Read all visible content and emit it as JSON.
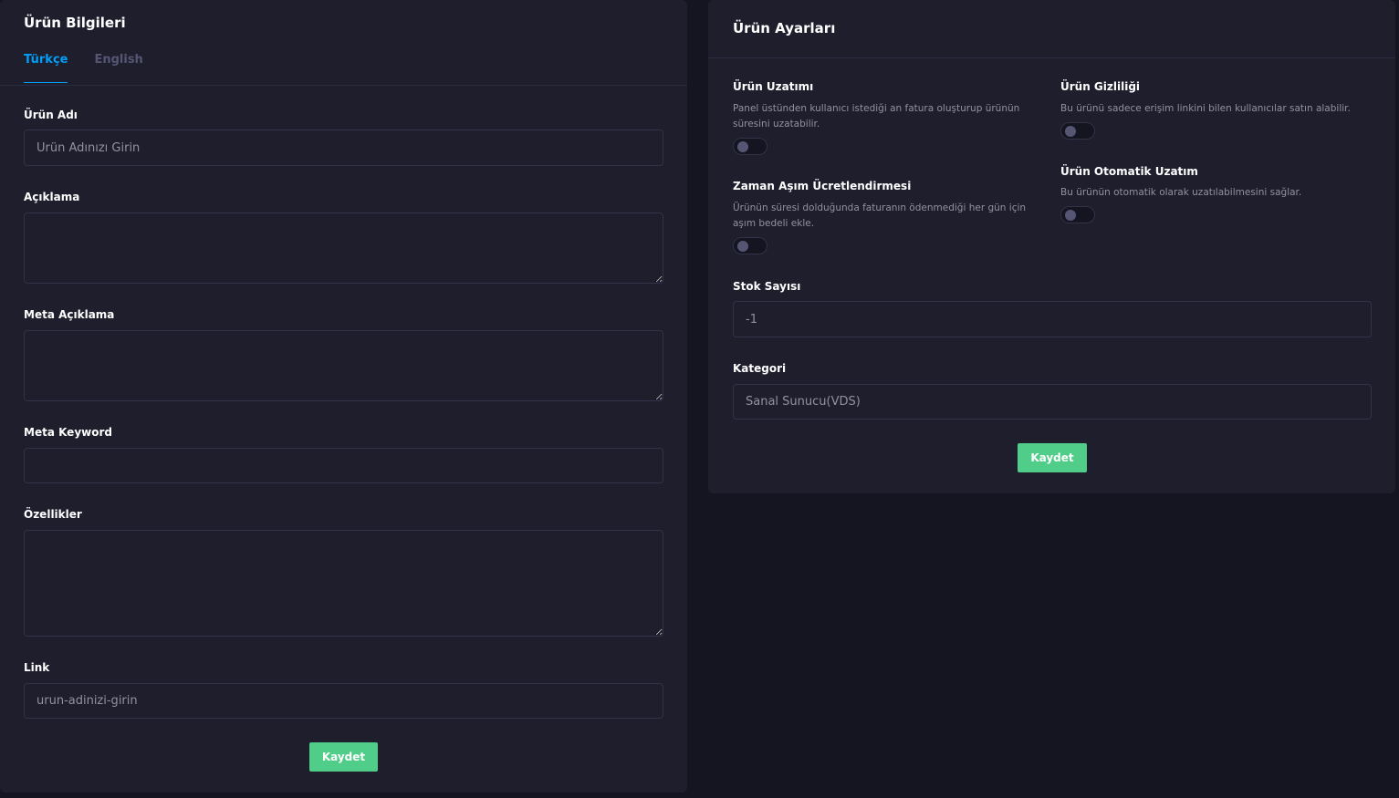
{
  "left": {
    "title": "Ürün Bilgileri",
    "tabs": [
      {
        "label": "Türkçe",
        "active": true
      },
      {
        "label": "English",
        "active": false
      }
    ],
    "fields": {
      "name": {
        "label": "Ürün Adı",
        "placeholder": "Ürün Adınızı Girin",
        "value": ""
      },
      "description": {
        "label": "Açıklama",
        "value": ""
      },
      "meta_description": {
        "label": "Meta Açıklama",
        "value": ""
      },
      "meta_keyword": {
        "label": "Meta Keyword",
        "value": ""
      },
      "features": {
        "label": "Özellikler",
        "value": ""
      },
      "link": {
        "label": "Link",
        "placeholder": "urun-adinizi-girin",
        "value": ""
      }
    },
    "save_label": "Kaydet"
  },
  "right": {
    "title": "Ürün Ayarları",
    "settings": {
      "extension": {
        "title": "Ürün Uzatımı",
        "desc": "Panel üstünden kullanıcı istediği an fatura oluşturup ürünün süresini uzatabilir.",
        "enabled": false
      },
      "privacy": {
        "title": "Ürün Gizliliği",
        "desc": "Bu ürünü sadece erişim linkini bilen kullanıcılar satın alabilir.",
        "enabled": false
      },
      "overdue": {
        "title": "Zaman Aşım Ücretlendirmesi",
        "desc": "Ürünün süresi dolduğunda faturanın ödenmediği her gün için aşım bedeli ekle.",
        "enabled": false
      },
      "auto_extension": {
        "title": "Ürün Otomatik Uzatım",
        "desc": "Bu ürünün otomatik olarak uzatılabilmesini sağlar.",
        "enabled": false
      }
    },
    "stock": {
      "label": "Stok Sayısı",
      "value": "-1"
    },
    "category": {
      "label": "Kategori",
      "value": "Sanal Sunucu(VDS)"
    },
    "save_label": "Kaydet"
  },
  "colors": {
    "background": "#151521",
    "card": "#1e1e2d",
    "border": "#323248",
    "accent": "#009ef7",
    "success": "#50cd89",
    "muted": "#92929f"
  }
}
